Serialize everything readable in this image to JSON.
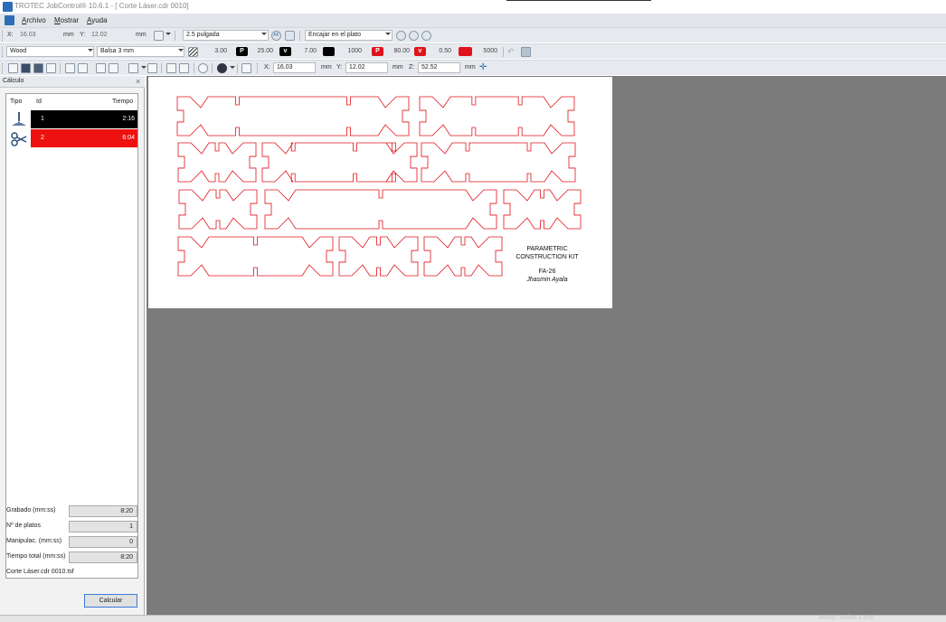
{
  "window": {
    "title": "TROTEC JobControl® 10.6.1 - [ Corte Láser.cdr 0010]"
  },
  "menu": {
    "items": [
      "Archivo",
      "Mostrar",
      "Ayuda"
    ]
  },
  "toolbar1": {
    "x_label": "X:",
    "x_value": "16.03",
    "x_unit": "mm",
    "y_label": "Y:",
    "y_value": "12.02",
    "y_unit": "mm",
    "lens": "2.5 pulgada",
    "af_label": "AF",
    "fit_option": "Encajar en el plato"
  },
  "toolbar2": {
    "material": "Wood",
    "thickness": "Balsa 3 mm",
    "params": [
      {
        "badge": "",
        "value": "3.00"
      },
      {
        "badge": "P",
        "value": "25.00",
        "color": "#000000"
      },
      {
        "badge": "v",
        "value": "7.00",
        "color": "#000000"
      },
      {
        "badge": "",
        "value": "1000",
        "color": "#000000"
      },
      {
        "badge": "P",
        "value": "80.00",
        "color": "#e0141b"
      },
      {
        "badge": "v",
        "value": "0.50",
        "color": "#e0141b"
      },
      {
        "badge": "",
        "value": "5000",
        "color": "#e0141b"
      }
    ]
  },
  "toolbar3": {
    "x_label": "X:",
    "x_value": "16.03",
    "x_unit": "mm",
    "y_label": "Y:",
    "y_value": "12.02",
    "y_unit": "mm",
    "z_label": "Z:",
    "z_value": "52.52",
    "z_unit": "mm"
  },
  "panel": {
    "title": "Cálculo",
    "columns": [
      "Tipo",
      "Id",
      "Tiempo"
    ],
    "jobs": [
      {
        "type_icon": "engrave-icon",
        "id": "1",
        "time": "2:16",
        "color": "#000000"
      },
      {
        "type_icon": "scissors-icon",
        "id": "2",
        "time": "6:04",
        "color": "#ee1111"
      }
    ],
    "summary": [
      {
        "label": "Grabado (mm:ss)",
        "value": "8:20"
      },
      {
        "label": "Nº de platos",
        "value": "1"
      },
      {
        "label": "Manipulac. (mm:ss)",
        "value": "0"
      },
      {
        "label": "Tiempo total (mm:ss)",
        "value": "8:20"
      }
    ],
    "filename": "Corte Láser.cdr 0010.tsf",
    "calc_button": "Calcular"
  },
  "plate": {
    "title_line1": "PARAMETRIC",
    "title_line2": "CONSTRUCTION KIT",
    "code": "FA-26",
    "author": "Jhasmin Ayala",
    "cut_color": "#e0141b"
  },
  "status": {
    "text": "Wood - Balsa 3 mm"
  }
}
